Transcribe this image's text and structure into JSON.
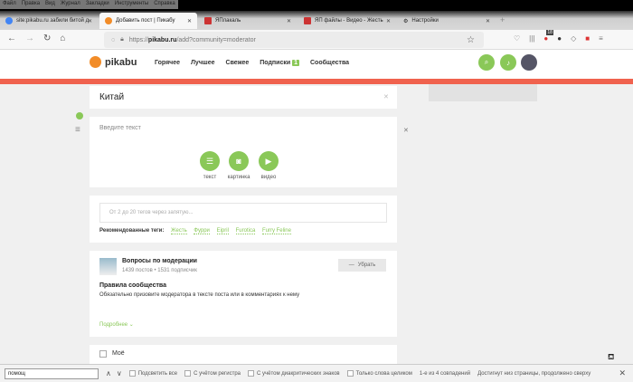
{
  "menu": [
    "Файл",
    "Правка",
    "Вид",
    "Журнал",
    "Закладки",
    "Инструменты",
    "Справка"
  ],
  "tabs": [
    {
      "label": "site:pikabu.ru забили битой д",
      "icon": "google-icon",
      "color": "#4285f4"
    },
    {
      "label": "Добавить пост | Пикабу",
      "icon": "pikabu-icon",
      "color": "#f28c28"
    },
    {
      "label": "ЯПлакаль",
      "icon": "yaplakal-icon",
      "color": "#c33"
    },
    {
      "label": "ЯП файлы - Видео - Жесть",
      "icon": "yapfiles-icon",
      "color": "#c33"
    },
    {
      "label": "Настройки",
      "icon": "gear-icon",
      "color": "#555"
    }
  ],
  "url": {
    "prefix": "https://",
    "domain": "pikabu.ru",
    "path": "/add?community=moderator"
  },
  "toolbar_badge": "18",
  "site": {
    "logo": "pikabu",
    "nav": [
      "Горячее",
      "Лучшее",
      "Свежее",
      "Подписки",
      "Сообщества"
    ],
    "subs_badge": "1",
    "accent": "#8ac858",
    "bar_color": "#f0624e"
  },
  "post": {
    "title": "Китай",
    "text_placeholder": "Введите текст",
    "buttons": [
      "текст",
      "картинка",
      "видео"
    ]
  },
  "tags": {
    "placeholder": "От 2 до 20 тегов через запятую...",
    "recommended_label": "Рекомендованные теги:",
    "items": [
      "Жесть",
      "Фурри",
      "Eipril",
      "Furotica",
      "Furry Feline"
    ]
  },
  "community": {
    "name": "Вопросы по модерации",
    "stats": "1439 постов • 1531 подписчик",
    "remove": "Убрать",
    "rules_title": "Правила сообщества",
    "rules_text": "Обязательно призовите модератора в тексте поста или в комментариях к нему",
    "more": "Подробнее"
  },
  "mine": {
    "label": "Моё"
  },
  "find": {
    "value": "помощ",
    "highlight_all": "Подсветить все",
    "match_case": "С учётом регистра",
    "diacritics": "С учётом диакритических знаков",
    "whole_words": "Только слова целиком",
    "count": "1-е из 4 совпадений",
    "status": "Достигнут низ страницы, продолжено сверху"
  }
}
